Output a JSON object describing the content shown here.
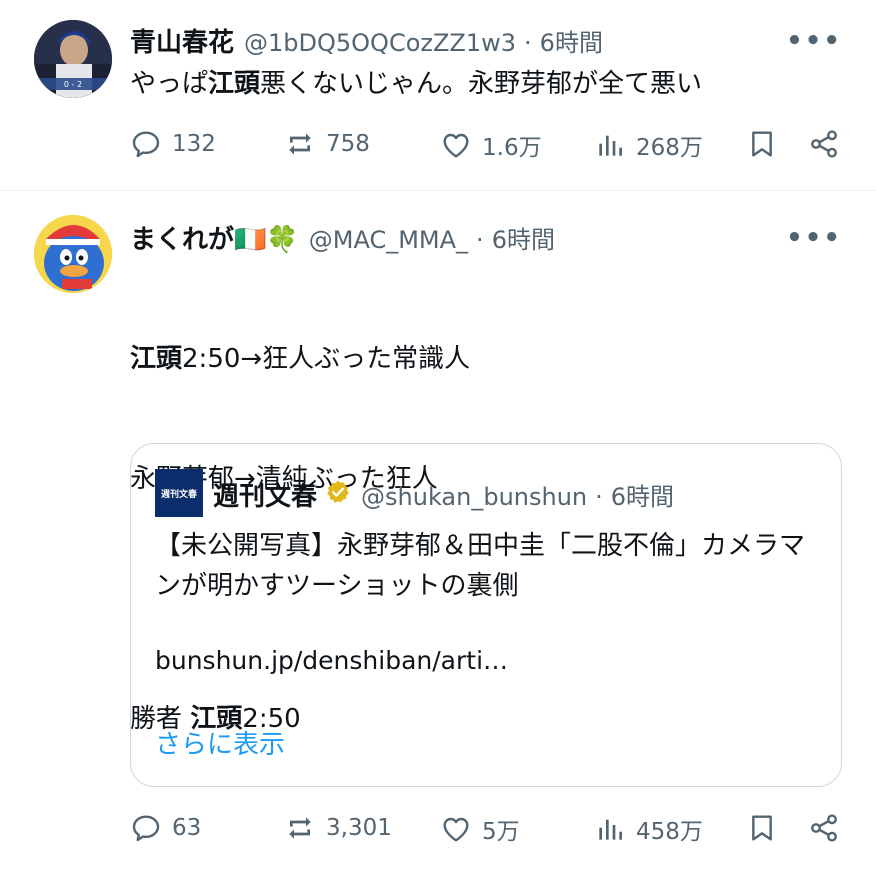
{
  "tweet1": {
    "name": "青山春花",
    "handle": "@1bDQ5OQCozZZ1w3",
    "dot": "·",
    "time": "6時間",
    "more": "•••",
    "text_part1": "やっぱ",
    "text_bold": "江頭",
    "text_part2": "悪くないじゃん。永野芽郁が全て悪い",
    "avatar_scoreboard": "0 - 2",
    "actions": {
      "replies": "132",
      "reposts": "758",
      "likes": "1.6万",
      "views": "268万"
    }
  },
  "tweet2": {
    "name": "まくれが🇮🇪🍀",
    "handle": "@MAC_MMA_",
    "dot": "·",
    "time": "6時間",
    "more": "•••",
    "line1_bold": "江頭",
    "line1_rest": "2:50→狂人ぶった常識人",
    "line2": "永野芽郁→清純ぶった狂人",
    "line3_prefix": "勝者 ",
    "line3_bold": "江頭",
    "line3_rest": "2:50",
    "quote": {
      "logo_text": "週刊文春",
      "name": "週刊文春",
      "handle": "@shukan_bunshun",
      "dot": "·",
      "time": "6時間",
      "text": "【未公開写真】永野芽郁＆田中圭「二股不倫」カメラマンが明かすツーショットの裏側",
      "link": "bunshun.jp/denshiban/arti…",
      "ellipsis": "…",
      "show_more": "さらに表示"
    },
    "actions": {
      "replies": "63",
      "reposts": "3,301",
      "likes": "5万",
      "views": "458万"
    }
  },
  "colors": {
    "text": "#0f1419",
    "secondary": "#536471",
    "link": "#1d9bf0",
    "verified": "#e2b719",
    "border": "#cfd9de"
  }
}
